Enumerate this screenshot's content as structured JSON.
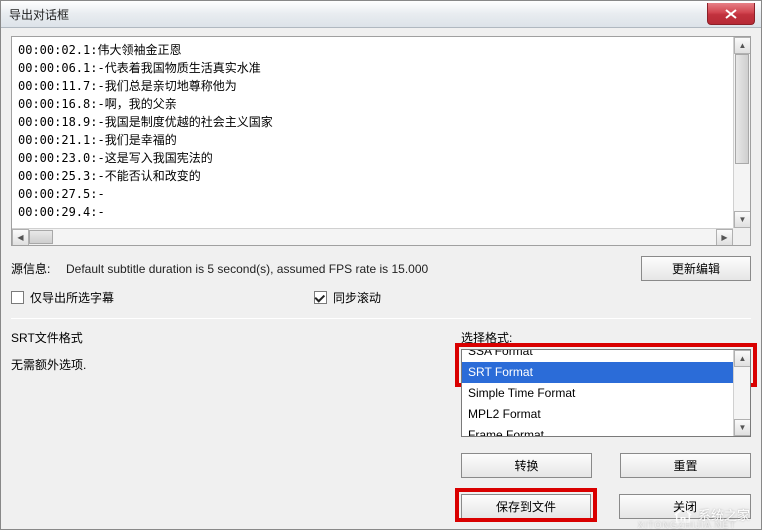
{
  "titlebar": {
    "title": "导出对话框"
  },
  "subtitles": {
    "lines": [
      "00:00:02.1:伟大领袖金正恩",
      "00:00:06.1:-代表着我国物质生活真实水准",
      "00:00:11.7:-我们总是亲切地尊称他为",
      "00:00:16.8:-啊，我的父亲",
      "00:00:18.9:-我国是制度优越的社会主义国家",
      "00:00:21.1:-我们是幸福的",
      "00:00:23.0:-这是写入我国宪法的",
      "00:00:25.3:-不能否认和改变的",
      "00:00:27.5:-",
      "00:00:29.4:-"
    ]
  },
  "source": {
    "label": "源信息:",
    "text": "Default subtitle duration is 5 second(s), assumed FPS rate is 15.000"
  },
  "buttons": {
    "update_edit": "更新编辑",
    "convert": "转换",
    "reset": "重置",
    "save_file": "保存到文件",
    "close": "关闭"
  },
  "checks": {
    "export_selected": "仅导出所选字幕",
    "sync_scroll": "同步滚动"
  },
  "format": {
    "title": "SRT文件格式",
    "note": "无需额外选项."
  },
  "selector": {
    "label": "选择格式:",
    "options": [
      "SSA Format",
      "SRT Format",
      "Simple Time Format",
      "MPL2 Format",
      "Frame Format"
    ]
  },
  "watermark": {
    "main": "系统之家",
    "sub": "XITONGZHIJIA.NET"
  }
}
